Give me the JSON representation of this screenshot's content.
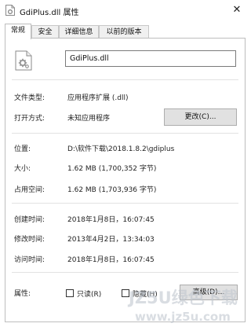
{
  "window": {
    "title": "GdiPlus.dll 属性",
    "close_glyph": "✕"
  },
  "tabs": [
    {
      "label": "常规",
      "active": true
    },
    {
      "label": "安全"
    },
    {
      "label": "详细信息"
    },
    {
      "label": "以前的版本"
    }
  ],
  "file": {
    "name": "GdiPlus.dll"
  },
  "props": {
    "type_label": "文件类型:",
    "type_value": "应用程序扩展 (.dll)",
    "open_label": "打开方式:",
    "open_value": "未知应用程序",
    "change_button": "更改(C)...",
    "location_label": "位置:",
    "location_value": "D:\\软件下载\\2018.1.8.2\\gdiplus",
    "size_label": "大小:",
    "size_value": "1.62 MB (1,700,352 字节)",
    "disk_label": "占用空间:",
    "disk_value": "1.62 MB (1,703,936 字节)",
    "created_label": "创建时间:",
    "created_value": "2018年1月8日，16:07:45",
    "modified_label": "修改时间:",
    "modified_value": "2013年4月2日，13:34:03",
    "accessed_label": "访问时间:",
    "accessed_value": "2018年1月8日，16:07:45",
    "attr_label": "属性:",
    "readonly_label": "只读(R)",
    "hidden_label": "隐藏(H)",
    "advanced_button": "高级(D)..."
  },
  "watermark": {
    "text": "JZ5U绿色下载",
    "url": "www.jz5u.com"
  }
}
